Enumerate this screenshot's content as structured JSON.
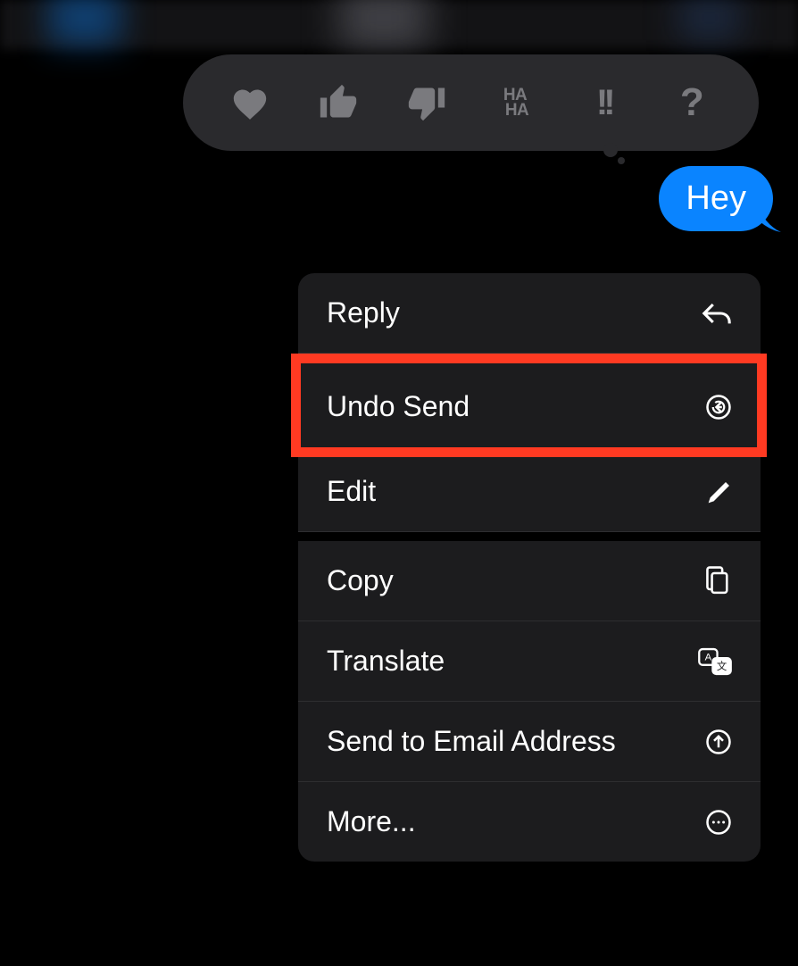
{
  "message": {
    "text": "Hey",
    "bubble_color": "#0A84FF"
  },
  "reactions": {
    "heart": "heart-icon",
    "thumbs_up": "thumbs-up-icon",
    "thumbs_down": "thumbs-down-icon",
    "haha_top": "HA",
    "haha_bottom": "HA",
    "exclaim": "!!",
    "question": "?"
  },
  "menu": {
    "reply": {
      "label": "Reply"
    },
    "undo_send": {
      "label": "Undo Send"
    },
    "edit": {
      "label": "Edit"
    },
    "copy": {
      "label": "Copy"
    },
    "translate": {
      "label": "Translate"
    },
    "send_email": {
      "label": "Send to Email Address"
    },
    "more": {
      "label": "More..."
    }
  },
  "highlight": {
    "target": "undo_send",
    "color": "#FF3A22"
  }
}
